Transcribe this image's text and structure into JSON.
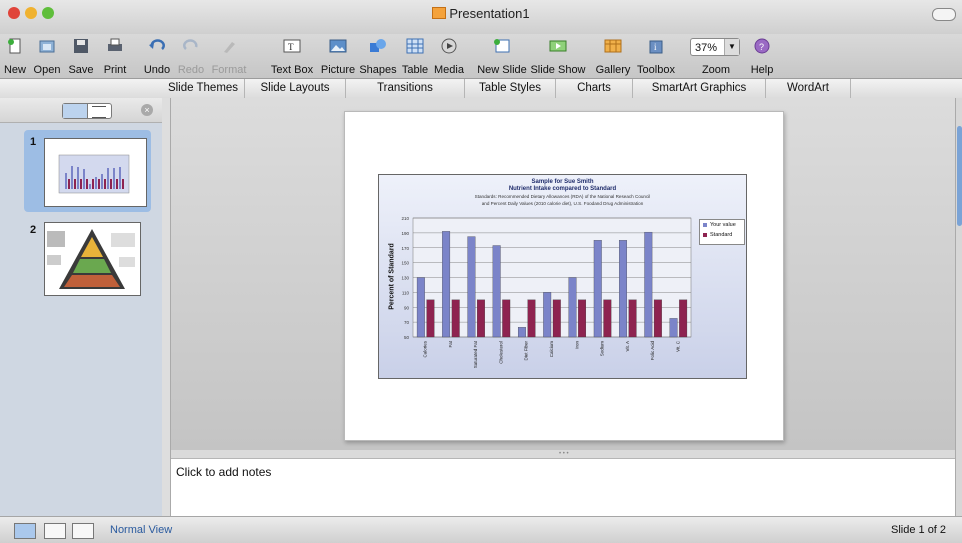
{
  "window": {
    "title": "Presentation1"
  },
  "toolbar": {
    "buttons": [
      {
        "label": "New",
        "icon": "new-icon",
        "enabled": true
      },
      {
        "label": "Open",
        "icon": "open-icon",
        "enabled": true
      },
      {
        "label": "Save",
        "icon": "save-icon",
        "enabled": true
      },
      {
        "label": "Print",
        "icon": "print-icon",
        "enabled": true
      },
      {
        "label": "Undo",
        "icon": "undo-icon",
        "enabled": true
      },
      {
        "label": "Redo",
        "icon": "redo-icon",
        "enabled": false
      },
      {
        "label": "Format",
        "icon": "format-brush-icon",
        "enabled": false
      },
      {
        "label": "Text Box",
        "icon": "text-box-icon",
        "enabled": true
      },
      {
        "label": "Picture",
        "icon": "picture-icon",
        "enabled": true
      },
      {
        "label": "Shapes",
        "icon": "shapes-icon",
        "enabled": true
      },
      {
        "label": "Table",
        "icon": "table-icon",
        "enabled": true
      },
      {
        "label": "Media",
        "icon": "media-icon",
        "enabled": true
      },
      {
        "label": "New Slide",
        "icon": "new-slide-icon",
        "enabled": true
      },
      {
        "label": "Slide Show",
        "icon": "slide-show-icon",
        "enabled": true
      },
      {
        "label": "Gallery",
        "icon": "gallery-icon",
        "enabled": true
      },
      {
        "label": "Toolbox",
        "icon": "toolbox-icon",
        "enabled": true
      },
      {
        "label": "Zoom",
        "icon": "zoom-icon",
        "enabled": true
      },
      {
        "label": "Help",
        "icon": "help-icon",
        "enabled": true
      }
    ],
    "zoom_value": "37%"
  },
  "ribbon": {
    "tabs": [
      "Slide Themes",
      "Slide Layouts",
      "Transitions",
      "Table Styles",
      "Charts",
      "SmartArt Graphics",
      "WordArt"
    ]
  },
  "sidebar": {
    "slides": [
      {
        "number": "1"
      },
      {
        "number": "2"
      }
    ]
  },
  "notes": {
    "placeholder": "Click to add notes"
  },
  "status": {
    "view_label": "Normal View",
    "slide_counter": "Slide 1 of 2"
  },
  "colors": {
    "your_value": "#7b84c9",
    "standard": "#8e2350",
    "selection": "#9dbde4"
  },
  "chart_data": {
    "type": "bar",
    "title": "Sample for Sue Smith",
    "subtitle": "Nutrient Intake compared to Standard",
    "note_line1": "Standards: Recommended Dietary Allowances (RDA) of the National Reseach Council",
    "note_line2": "and Percent Daily Values (2010 calorie diet), U.S. Foodand Drug Administration",
    "ylabel": "Percent of Standard",
    "xlabel": "",
    "ylim": [
      50,
      210
    ],
    "yticks": [
      50,
      70,
      90,
      110,
      130,
      150,
      170,
      190,
      210
    ],
    "categories": [
      "Calories",
      "Fat",
      "Saturated Fat",
      "Cholesterol",
      "Diet Fiber",
      "Calcium",
      "Iron",
      "Sodium",
      "Vit. A",
      "Folic Acid",
      "Vit. C"
    ],
    "series": [
      {
        "name": "Your value",
        "values": [
          130,
          192,
          185,
          173,
          63,
          110,
          130,
          180,
          180,
          191,
          75
        ]
      },
      {
        "name": "Standard",
        "values": [
          100,
          100,
          100,
          100,
          100,
          100,
          100,
          100,
          100,
          100,
          100
        ]
      }
    ],
    "grid": true,
    "legend": "right"
  }
}
